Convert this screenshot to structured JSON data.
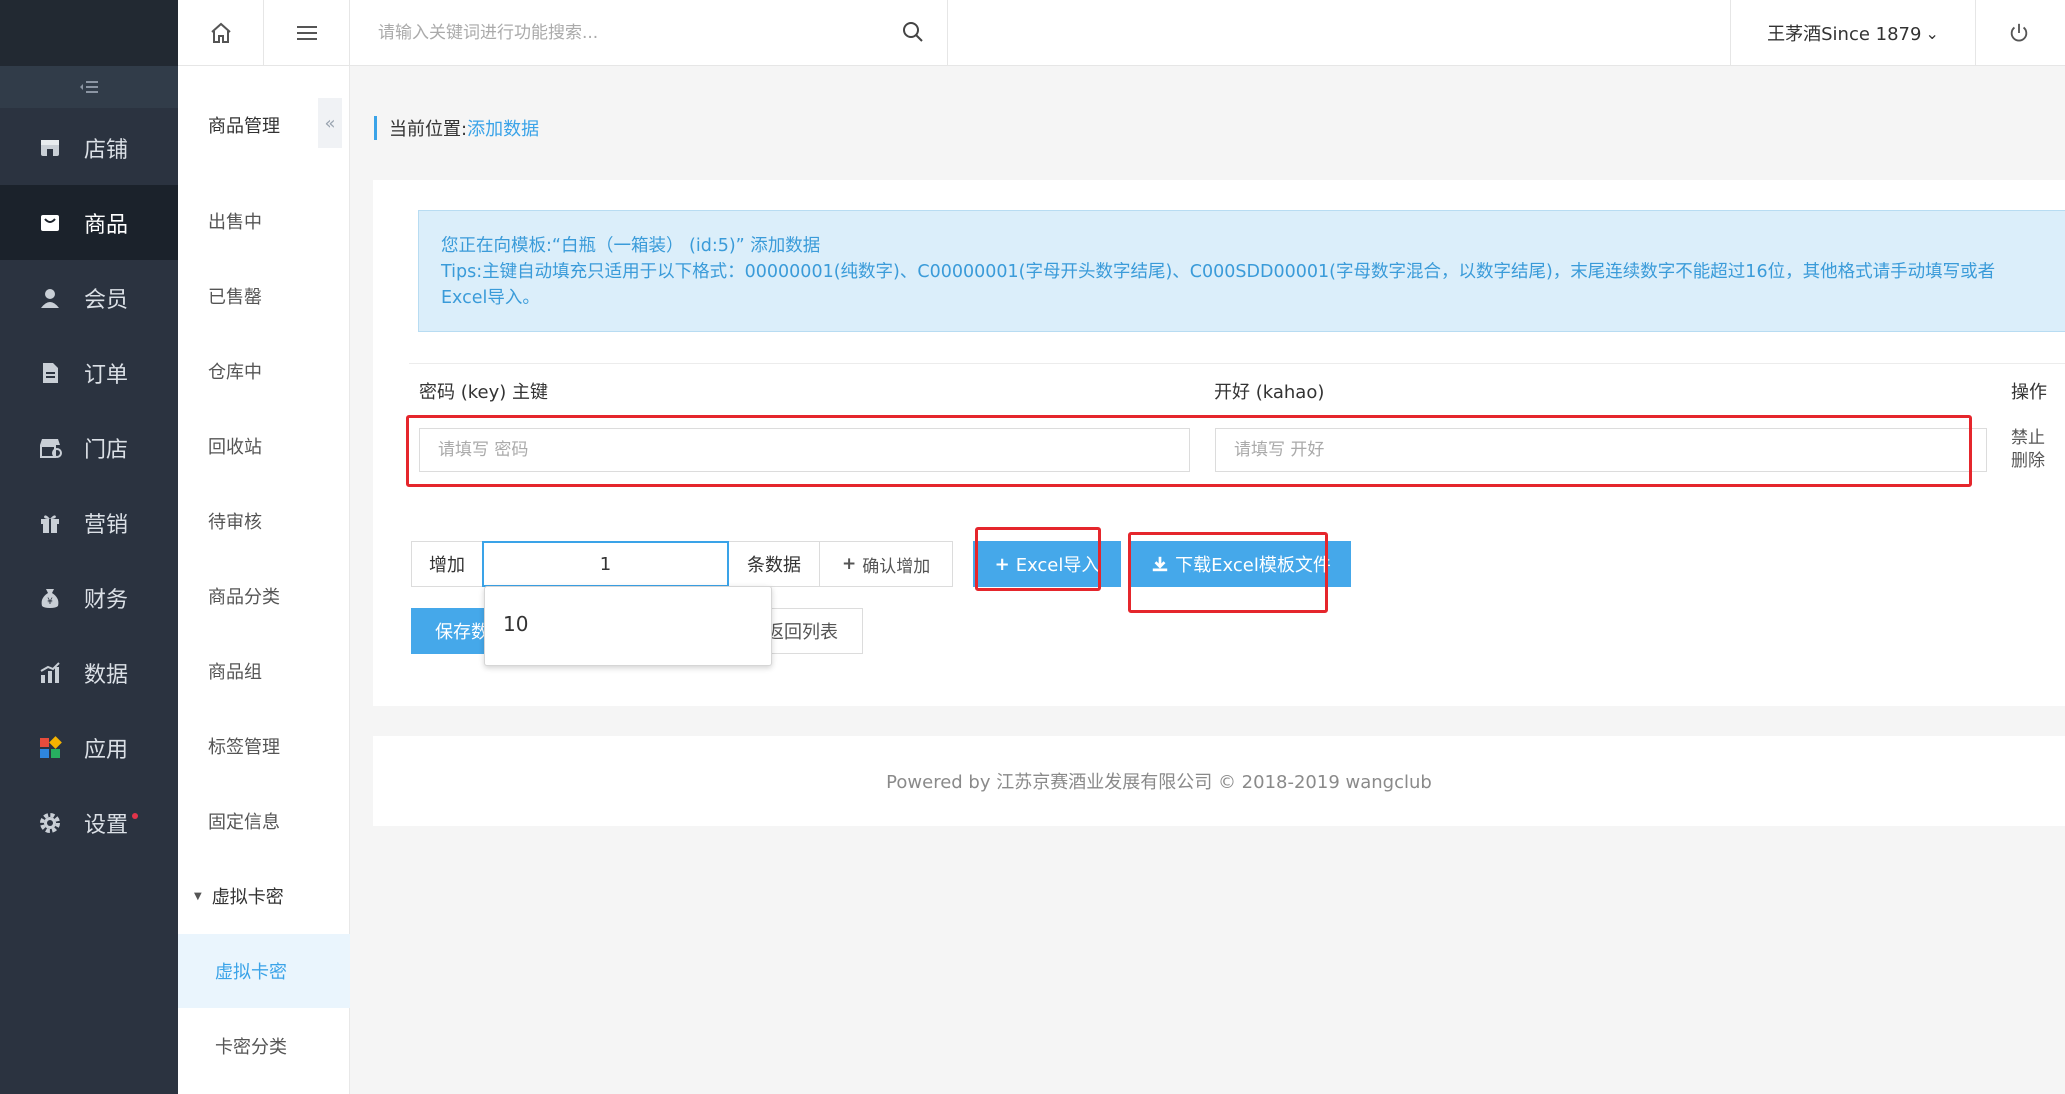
{
  "primary_nav": {
    "items": [
      {
        "label": "店铺",
        "icon": "store-icon"
      },
      {
        "label": "商品",
        "icon": "goods-icon"
      },
      {
        "label": "会员",
        "icon": "user-icon"
      },
      {
        "label": "订单",
        "icon": "order-icon"
      },
      {
        "label": "门店",
        "icon": "shop-icon"
      },
      {
        "label": "营销",
        "icon": "gift-icon"
      },
      {
        "label": "财务",
        "icon": "money-bag-icon"
      },
      {
        "label": "数据",
        "icon": "bar-chart-icon"
      },
      {
        "label": "应用",
        "icon": "apps-icon"
      },
      {
        "label": "设置",
        "icon": "gear-icon"
      }
    ],
    "active_index": 1
  },
  "secondary_nav": {
    "title": "商品管理",
    "items": [
      "出售中",
      "已售罄",
      "仓库中",
      "回收站",
      "待审核",
      "商品分类",
      "商品组",
      "标签管理",
      "固定信息"
    ],
    "group_label": "虚拟卡密",
    "sub_items": [
      "虚拟卡密",
      "卡密分类"
    ],
    "active_sub_index": 0
  },
  "topbar": {
    "search_placeholder": "请输入关键词进行功能搜索...",
    "user_name": "王茅酒Since 1879",
    "user_chevron": "⌄"
  },
  "breadcrumb": {
    "label": "当前位置:",
    "current": "添加数据"
  },
  "alert": {
    "line1": "您正在向模板:“白瓶（一箱装） (id:5)” 添加数据",
    "line2": "Tips:主键自动填充只适用于以下格式：00000001(纯数字)、C00000001(字母开头数字结尾)、C000SDD00001(字母数字混合，以数字结尾)，末尾连续数字不能超过16位，其他格式请手动填写或者Excel导入。"
  },
  "table": {
    "col_key": "密码 (key) 主键",
    "col_kahao": "开好 (kahao)",
    "col_ops": "操作",
    "key_placeholder": "请填写 密码",
    "kahao_placeholder": "请填写 开好",
    "op_disable": "禁止",
    "op_delete": "删除"
  },
  "add_bar": {
    "prefix": "增加",
    "count_value": "1",
    "unit": "条数据",
    "confirm_label": "确认增加",
    "excel_import_label": "Excel导入",
    "download_template_label": "下载Excel模板文件"
  },
  "dropdown": {
    "option": "10"
  },
  "actions": {
    "save_label": "保存数",
    "back_label": "返回列表"
  },
  "footer": {
    "text": "Powered by 江苏京赛酒业发展有限公司 © 2018-2019 wangclub"
  },
  "colors": {
    "sidebar_bg": "#2b3340",
    "accent_blue": "#3aa3e8",
    "button_blue": "#45a8ea",
    "highlight_red": "#e5262c",
    "alert_bg": "#dbeefa"
  }
}
